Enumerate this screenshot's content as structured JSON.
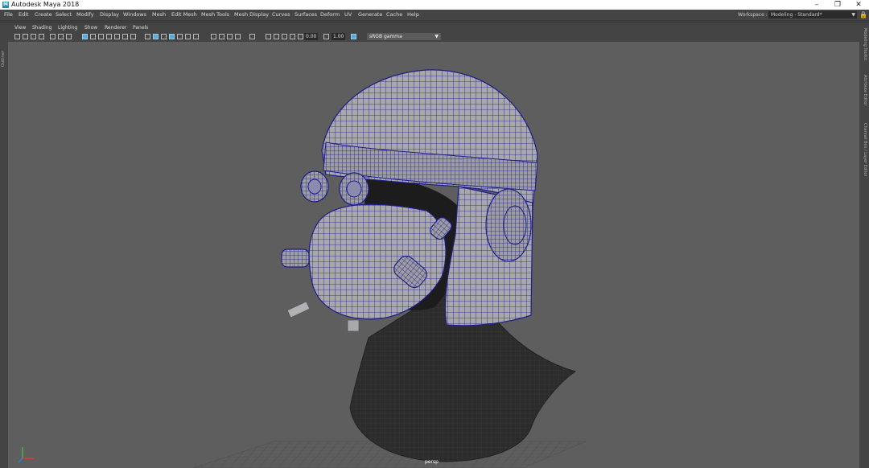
{
  "titlebar": {
    "title": "Autodesk Maya 2018",
    "app_icon": "M",
    "minimize": "–",
    "restore": "❐",
    "close": "✕"
  },
  "menubar": {
    "items": [
      "File",
      "Edit",
      "Create",
      "Select",
      "Modify",
      "Display",
      "Windows",
      "Mesh",
      "Edit Mesh",
      "Mesh Tools",
      "Mesh Display",
      "Curves",
      "Surfaces",
      "Deform",
      "UV",
      "Generate",
      "Cache",
      "Help"
    ],
    "workspace_label": "Workspace :",
    "workspace_value": "Modeling - Standard*"
  },
  "left_strip": {
    "tab": "Outliner"
  },
  "right_strip": {
    "tabs": [
      "Modeling Toolkit",
      "Attribute Editor",
      "Channel Box / Layer Editor"
    ]
  },
  "panel_menu": {
    "items": [
      "View",
      "Shading",
      "Lighting",
      "Show",
      "Renderer",
      "Panels"
    ]
  },
  "viewport_toolbar": {
    "exposure": "0.00",
    "gamma": "1.00",
    "color_space": "sRGB gamma"
  },
  "viewport": {
    "camera": "persp"
  },
  "colors": {
    "wire": "#1d1d8c",
    "mesh_gray": "#a9a9ad",
    "neck_dark": "#2a2a2a",
    "accent": "#5aa9d6"
  }
}
